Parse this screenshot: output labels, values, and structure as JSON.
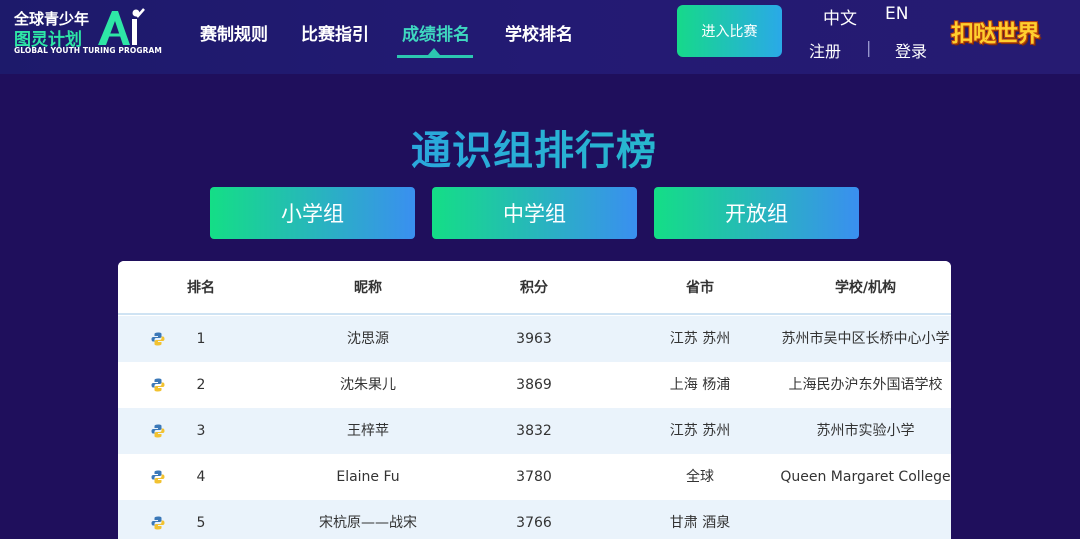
{
  "header": {
    "logo_line1": "全球青少年",
    "logo_line2": "图灵计划",
    "logo_line3": "GLOBAL YOUTH TURING PROGRAM",
    "logo_ai": "AI",
    "nav": [
      "赛制规则",
      "比赛指引",
      "成绩排名",
      "学校排名"
    ],
    "active_nav": "成绩排名",
    "enter_button": "进入比赛",
    "lang_zh": "中文",
    "lang_en": "EN",
    "register": "注册",
    "separator": "|",
    "login": "登录",
    "brand": "扣哒世界"
  },
  "page_title": "通识组排行榜",
  "groups": [
    "小学组",
    "中学组",
    "开放组"
  ],
  "table": {
    "columns": [
      "排名",
      "昵称",
      "积分",
      "省市",
      "学校/机构"
    ],
    "rows": [
      {
        "rank": "1",
        "nickname": "沈思源",
        "score": "3963",
        "province": "江苏 苏州",
        "school": "苏州市吴中区长桥中心小学"
      },
      {
        "rank": "2",
        "nickname": "沈朱果儿",
        "score": "3869",
        "province": "上海 杨浦",
        "school": "上海民办沪东外国语学校"
      },
      {
        "rank": "3",
        "nickname": "王梓苹",
        "score": "3832",
        "province": "江苏 苏州",
        "school": "苏州市实验小学"
      },
      {
        "rank": "4",
        "nickname": "Elaine Fu",
        "score": "3780",
        "province": "全球",
        "school": "Queen Margaret College"
      },
      {
        "rank": "5",
        "nickname": "宋杭原——战宋",
        "score": "3766",
        "province": "甘肃 酒泉",
        "school": ""
      }
    ],
    "row_icon": "python-icon"
  },
  "colors": {
    "background": "#1f0f5c",
    "accent_green": "#14de86",
    "accent_blue": "#3a8ff0",
    "active_nav": "#3fd7c0",
    "row_alt": "#eaf3fb"
  }
}
